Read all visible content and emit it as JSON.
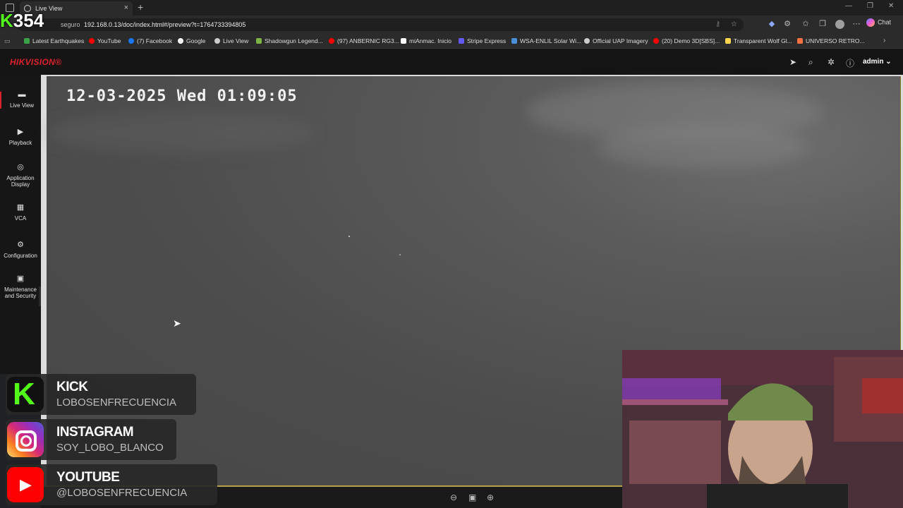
{
  "browser": {
    "tab_title": "Live View",
    "tab_close": "×",
    "new_tab": "+",
    "security_label": "seguro",
    "url": "192.168.0.13/doc/index.html#/preview?t=1764733394805",
    "chat_label": "Chat",
    "window_min": "—",
    "window_max": "❐",
    "window_close": "✕"
  },
  "bookmarks": [
    {
      "label": "Latest Earthquakes",
      "color": "#3aa34a"
    },
    {
      "label": "YouTube",
      "color": "#ff0000"
    },
    {
      "label": "(7) Facebook",
      "color": "#1877f2"
    },
    {
      "label": "Google",
      "color": "#ffffff"
    },
    {
      "label": "Live View",
      "color": "#cccccc"
    },
    {
      "label": "Shadowgun Legend...",
      "color": "#7cb342"
    },
    {
      "label": "(97) ANBERNIC RG3...",
      "color": "#ff0000"
    },
    {
      "label": "miAnmac. Inicio",
      "color": "#ffffff"
    },
    {
      "label": "Stripe Express",
      "color": "#635bff"
    },
    {
      "label": "WSA-ENLIL Solar Wi...",
      "color": "#4a90d9"
    },
    {
      "label": "Official UAP Imagery",
      "color": "#cccccc"
    },
    {
      "label": "(20) Demo 3D[SBS]...",
      "color": "#ff0000"
    },
    {
      "label": "Transparent Wolf Gl...",
      "color": "#ffd54f"
    },
    {
      "label": "UNIVERSO RETRO...",
      "color": "#ff7043"
    }
  ],
  "stream_overlay": {
    "kick_count_k": "K",
    "kick_count": "354"
  },
  "hikvision": {
    "logo": "HIKVISION®",
    "user": "admin",
    "nav": [
      {
        "label": "Live View",
        "icon": "live-view-icon"
      },
      {
        "label": "Playback",
        "icon": "playback-icon"
      },
      {
        "label": "Application Display",
        "icon": "application-icon"
      },
      {
        "label": "VCA",
        "icon": "vca-icon"
      },
      {
        "label": "Configuration",
        "icon": "gear-icon"
      },
      {
        "label": "Maintenance and Security",
        "icon": "maintenance-icon"
      }
    ],
    "osd_timestamp": "12-03-2025 Wed 01:09:05"
  },
  "socials": [
    {
      "title": "KICK",
      "handle": "LOBOSENFRECUENCIA"
    },
    {
      "title": "INSTAGRAM",
      "handle": "SOY_LOBO_BLANCO"
    },
    {
      "title": "YOUTUBE",
      "handle": "@LOBOSENFRECUENCIA"
    }
  ],
  "colors": {
    "brand_red": "#d9232d",
    "kick_green": "#53fc18"
  }
}
